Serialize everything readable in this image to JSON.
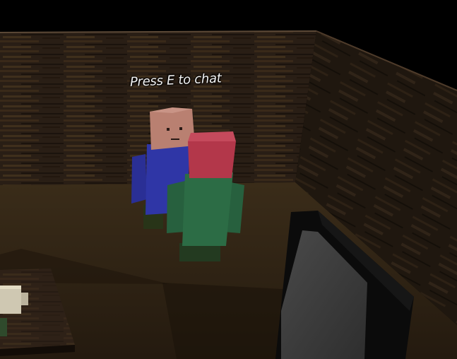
{
  "hud": {
    "interact_prompt": "Press E to chat"
  },
  "scene": {
    "room": {
      "back_wall": "wood-panel-wall",
      "right_wall": "wood-panel-wall",
      "floor": "wood-floor"
    },
    "characters": [
      {
        "name": "npc-blue-shirt",
        "head_color": "#b98071",
        "body_color": "#2f36a6",
        "legs_color": "#283418"
      },
      {
        "name": "npc-green-shirt",
        "head_color": "#b3374a",
        "body_color": "#2c6c45",
        "legs_color": "#233a20"
      }
    ],
    "props": [
      "crt-monitor",
      "side-table",
      "coffee-mug"
    ]
  }
}
